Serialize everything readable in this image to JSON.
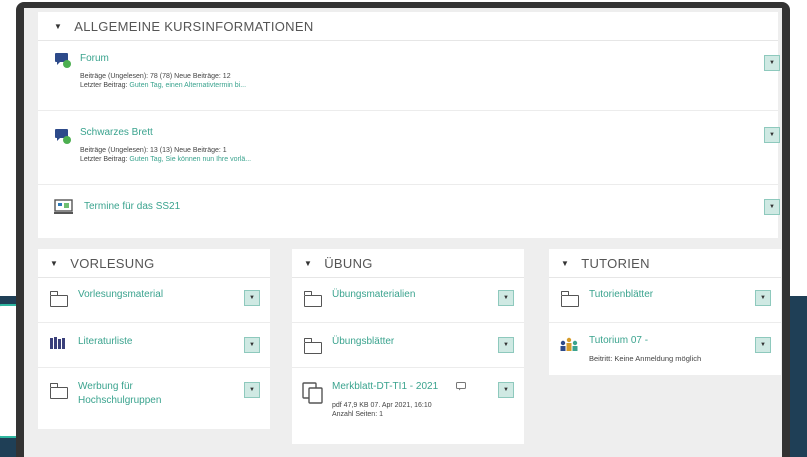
{
  "top_section": {
    "title": "ALLGEMEINE KURSINFORMATIONEN",
    "items": [
      {
        "title": "Forum",
        "meta_line1": "Beiträge (Ungelesen): 78 (78)   Neue Beiträge: 12",
        "meta_line2_label": "Letzter Beitrag: ",
        "meta_line2_link": "Guten Tag, einen Alternativtermin bi..."
      },
      {
        "title": "Schwarzes Brett",
        "meta_line1": "Beiträge (Ungelesen): 13 (13)   Neue Beiträge: 1",
        "meta_line2_label": "Letzter Beitrag: ",
        "meta_line2_link": "Guten Tag, Sie können nun Ihre vorlä..."
      },
      {
        "title": "Termine für das SS21"
      }
    ]
  },
  "vorlesung": {
    "title": "VORLESUNG",
    "items": [
      {
        "title": "Vorlesungsmaterial"
      },
      {
        "title": "Literaturliste"
      },
      {
        "title_line1": "Werbung für",
        "title_line2": "Hochschulgruppen"
      }
    ]
  },
  "uebung": {
    "title": "ÜBUNG",
    "items": [
      {
        "title": "Übungsmaterialien"
      },
      {
        "title": "Übungsblätter"
      },
      {
        "title": "Merkblatt-DT-TI1 - 2021",
        "meta_line1": "pdf   47,9 KB   07. Apr 2021, 16:10",
        "meta_line2": "Anzahl Seiten: 1"
      }
    ]
  },
  "tutorien": {
    "title": "TUTORIEN",
    "items": [
      {
        "title": "Tutorienblätter"
      },
      {
        "title": "Tutorium 07 -",
        "meta": "Beitritt: Keine Anmeldung möglich"
      }
    ]
  },
  "colors": {
    "accent": "#3aa38e",
    "button_bg": "#cfe9e3",
    "background_band": "#1f3f56",
    "frame_border": "#333333"
  },
  "icons": {
    "forum": "forum-icon",
    "board": "forum-icon",
    "calendar": "calendar-icon",
    "folder": "folder-icon",
    "books": "books-icon",
    "file": "file-icon",
    "group": "group-icon",
    "dropdown": "caret-down-icon"
  }
}
